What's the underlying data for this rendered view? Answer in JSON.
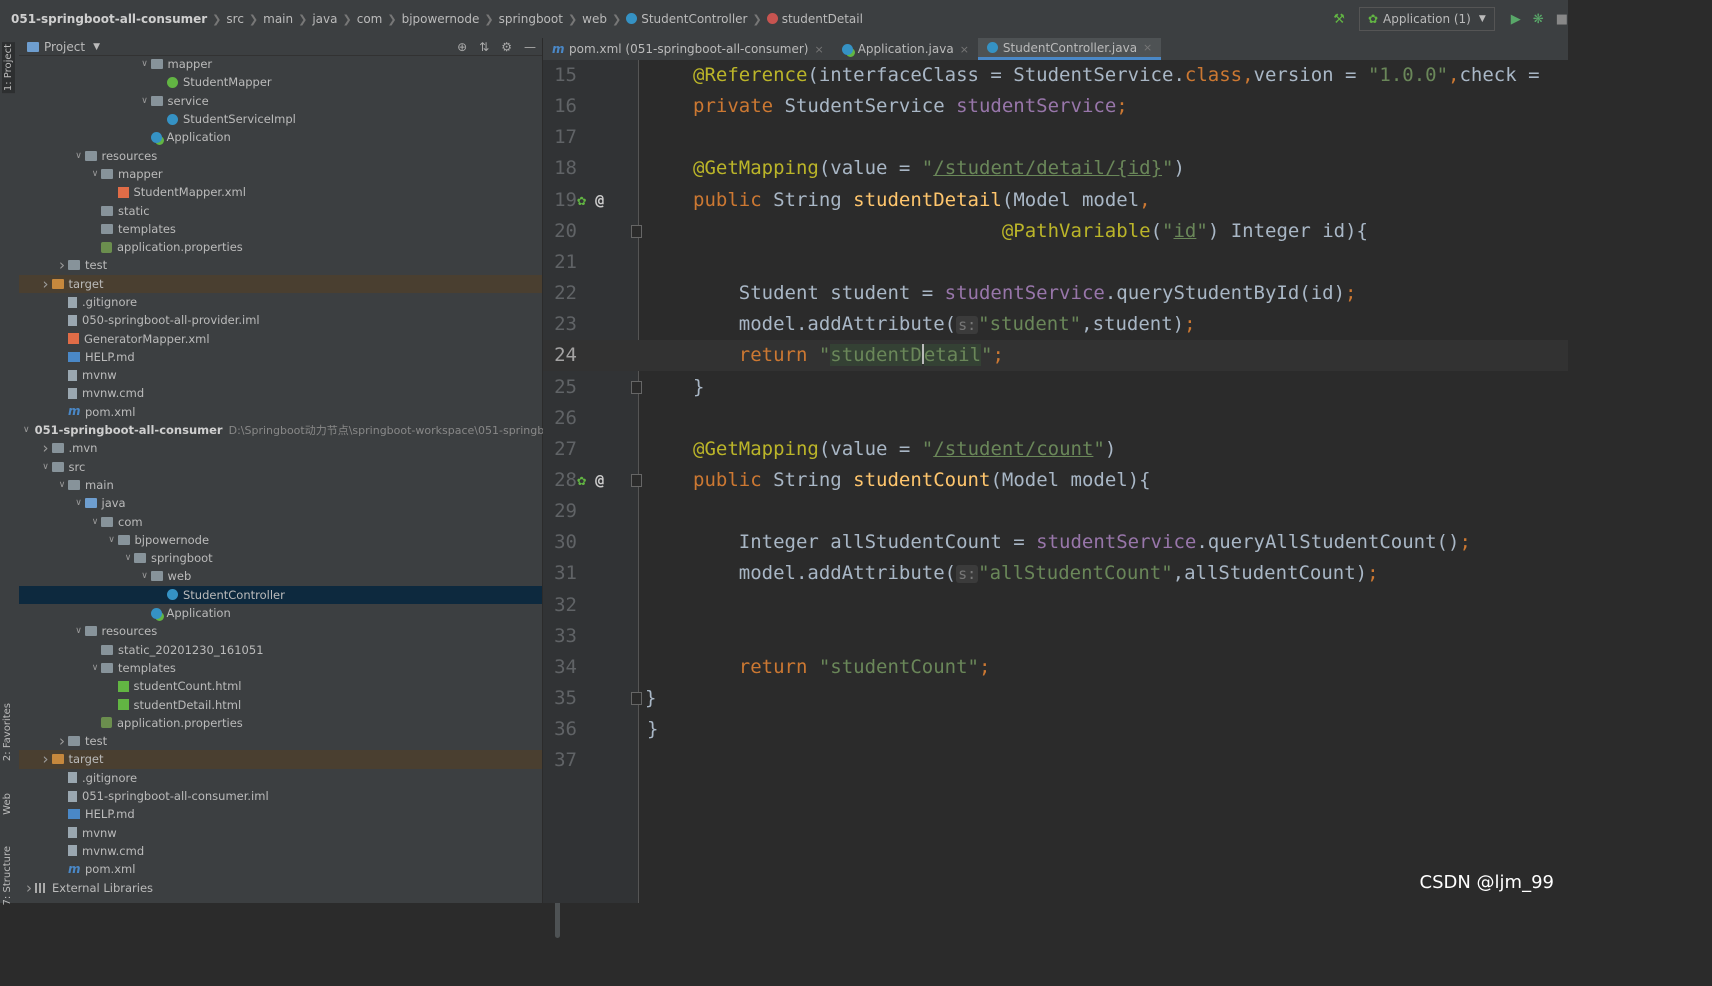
{
  "breadcrumbs": [
    "051-springboot-all-consumer",
    "src",
    "main",
    "java",
    "com",
    "bjpowernode",
    "springboot",
    "web",
    "StudentController",
    "studentDetail"
  ],
  "toolbar": {
    "run_config": "Application (1)"
  },
  "side_tabs": {
    "project": "1: Project",
    "favorites": "2: Favorites",
    "web": "Web",
    "structure": "7: Structure"
  },
  "project_panel": {
    "title": "Project"
  },
  "tree": [
    {
      "depth": 7,
      "arrow": "v",
      "icon": "folder",
      "label": "mapper"
    },
    {
      "depth": 8,
      "arrow": "",
      "icon": "iface",
      "label": "StudentMapper"
    },
    {
      "depth": 7,
      "arrow": "v",
      "icon": "folder",
      "label": "service"
    },
    {
      "depth": 8,
      "arrow": "",
      "icon": "class",
      "label": "StudentServiceImpl"
    },
    {
      "depth": 7,
      "arrow": "",
      "icon": "spring",
      "label": "Application"
    },
    {
      "depth": 3,
      "arrow": "v",
      "icon": "folder",
      "label": "resources"
    },
    {
      "depth": 4,
      "arrow": "v",
      "icon": "folder",
      "label": "mapper"
    },
    {
      "depth": 5,
      "arrow": "",
      "icon": "xml",
      "label": "StudentMapper.xml"
    },
    {
      "depth": 4,
      "arrow": "",
      "icon": "folder",
      "label": "static"
    },
    {
      "depth": 4,
      "arrow": "",
      "icon": "folder",
      "label": "templates"
    },
    {
      "depth": 4,
      "arrow": "",
      "icon": "props",
      "label": "application.properties"
    },
    {
      "depth": 2,
      "arrow": ">",
      "icon": "folder",
      "label": "test"
    },
    {
      "depth": 1,
      "arrow": ">",
      "icon": "folder-orange",
      "label": "target",
      "cls": "tgt"
    },
    {
      "depth": 2,
      "arrow": "",
      "icon": "file",
      "label": ".gitignore"
    },
    {
      "depth": 2,
      "arrow": "",
      "icon": "file",
      "label": "050-springboot-all-provider.iml"
    },
    {
      "depth": 2,
      "arrow": "",
      "icon": "xml",
      "label": "GeneratorMapper.xml"
    },
    {
      "depth": 2,
      "arrow": "",
      "icon": "md",
      "label": "HELP.md"
    },
    {
      "depth": 2,
      "arrow": "",
      "icon": "file",
      "label": "mvnw"
    },
    {
      "depth": 2,
      "arrow": "",
      "icon": "file",
      "label": "mvnw.cmd"
    },
    {
      "depth": 2,
      "arrow": "",
      "icon": "m",
      "label": "pom.xml"
    },
    {
      "depth": 0,
      "arrow": "v",
      "icon": "folder",
      "label": "051-springboot-all-consumer",
      "bold": true,
      "hint": "D:\\Springboot动力节点\\springboot-workspace\\051-springb"
    },
    {
      "depth": 1,
      "arrow": ">",
      "icon": "folder",
      "label": ".mvn"
    },
    {
      "depth": 1,
      "arrow": "v",
      "icon": "folder",
      "label": "src"
    },
    {
      "depth": 2,
      "arrow": "v",
      "icon": "folder",
      "label": "main"
    },
    {
      "depth": 3,
      "arrow": "v",
      "icon": "folder-blue",
      "label": "java"
    },
    {
      "depth": 4,
      "arrow": "v",
      "icon": "folder",
      "label": "com"
    },
    {
      "depth": 5,
      "arrow": "v",
      "icon": "folder",
      "label": "bjpowernode"
    },
    {
      "depth": 6,
      "arrow": "v",
      "icon": "folder",
      "label": "springboot"
    },
    {
      "depth": 7,
      "arrow": "v",
      "icon": "folder",
      "label": "web"
    },
    {
      "depth": 8,
      "arrow": "",
      "icon": "class",
      "label": "StudentController",
      "cls": "sel"
    },
    {
      "depth": 7,
      "arrow": "",
      "icon": "spring",
      "label": "Application"
    },
    {
      "depth": 3,
      "arrow": "v",
      "icon": "folder",
      "label": "resources"
    },
    {
      "depth": 4,
      "arrow": "",
      "icon": "folder",
      "label": "static_20201230_161051"
    },
    {
      "depth": 4,
      "arrow": "v",
      "icon": "folder",
      "label": "templates"
    },
    {
      "depth": 5,
      "arrow": "",
      "icon": "html",
      "label": "studentCount.html"
    },
    {
      "depth": 5,
      "arrow": "",
      "icon": "html",
      "label": "studentDetail.html"
    },
    {
      "depth": 4,
      "arrow": "",
      "icon": "props",
      "label": "application.properties"
    },
    {
      "depth": 2,
      "arrow": ">",
      "icon": "folder",
      "label": "test"
    },
    {
      "depth": 1,
      "arrow": ">",
      "icon": "folder-orange",
      "label": "target",
      "cls": "tgt"
    },
    {
      "depth": 2,
      "arrow": "",
      "icon": "file",
      "label": ".gitignore"
    },
    {
      "depth": 2,
      "arrow": "",
      "icon": "file",
      "label": "051-springboot-all-consumer.iml"
    },
    {
      "depth": 2,
      "arrow": "",
      "icon": "md",
      "label": "HELP.md"
    },
    {
      "depth": 2,
      "arrow": "",
      "icon": "file",
      "label": "mvnw"
    },
    {
      "depth": 2,
      "arrow": "",
      "icon": "file",
      "label": "mvnw.cmd"
    },
    {
      "depth": 2,
      "arrow": "",
      "icon": "m",
      "label": "pom.xml"
    },
    {
      "depth": 0,
      "arrow": ">",
      "icon": "libs",
      "label": "External Libraries"
    }
  ],
  "editor_tabs": [
    {
      "label": "pom.xml (051-springboot-all-consumer)",
      "icon": "m"
    },
    {
      "label": "Application.java",
      "icon": "spring"
    },
    {
      "label": "StudentController.java",
      "icon": "class",
      "active": true
    }
  ],
  "code_lines": [
    {
      "n": "15",
      "tokens": [
        [
          "ann",
          "@Reference"
        ],
        [
          "",
          "(interfaceClass = StudentService."
        ],
        [
          "kw",
          "class"
        ],
        [
          "kw",
          ","
        ],
        [
          "",
          "version = "
        ],
        [
          "str",
          "\"1.0.0\""
        ],
        [
          "kw",
          ","
        ],
        [
          "",
          "check ="
        ]
      ]
    },
    {
      "n": "16",
      "tokens": [
        [
          "kw",
          "private "
        ],
        [
          "",
          "StudentService "
        ],
        [
          "field",
          "studentService"
        ],
        [
          "kw",
          ";"
        ]
      ]
    },
    {
      "n": "17",
      "tokens": []
    },
    {
      "n": "18",
      "tokens": [
        [
          "ann",
          "@GetMapping"
        ],
        [
          "",
          "(value = "
        ],
        [
          "str",
          "\""
        ],
        [
          "url",
          "/student/detail/{id}"
        ],
        [
          "str",
          "\""
        ],
        [
          "",
          ")"
        ]
      ]
    },
    {
      "n": "19",
      "gutter": "bean",
      "tokens": [
        [
          "kw",
          "public "
        ],
        [
          "",
          "String "
        ],
        [
          "meth",
          "studentDetail"
        ],
        [
          "",
          "(Model model"
        ],
        [
          "kw",
          ","
        ]
      ]
    },
    {
      "n": "20",
      "fold": true,
      "tokens": [
        [
          "",
          "                           "
        ],
        [
          "ann",
          "@PathVariable"
        ],
        [
          "",
          "("
        ],
        [
          "str",
          "\""
        ],
        [
          "url",
          "id"
        ],
        [
          "str",
          "\""
        ],
        [
          "",
          ") Integer id){"
        ]
      ]
    },
    {
      "n": "21",
      "tokens": []
    },
    {
      "n": "22",
      "tokens": [
        [
          "",
          "    Student student = "
        ],
        [
          "field",
          "studentService"
        ],
        [
          "",
          ".queryStudentById(id)"
        ],
        [
          "kw",
          ";"
        ]
      ]
    },
    {
      "n": "23",
      "tokens": [
        [
          "",
          "    model.addAttribute("
        ],
        [
          "hint",
          "s:"
        ],
        [
          "str",
          "\"student\""
        ],
        [
          "",
          ","
        ],
        [
          "",
          "student)"
        ],
        [
          "kw",
          ";"
        ]
      ]
    },
    {
      "n": "24",
      "cur": true,
      "tokens": [
        [
          "kw",
          "    return "
        ],
        [
          "str",
          "\""
        ],
        [
          "strhl",
          "studentD"
        ],
        [
          "caret",
          ""
        ],
        [
          "strhl",
          "etail"
        ],
        [
          "str",
          "\""
        ],
        [
          "kw",
          ";"
        ]
      ]
    },
    {
      "n": "25",
      "fold": true,
      "tokens": [
        [
          "",
          "}"
        ]
      ]
    },
    {
      "n": "26",
      "tokens": []
    },
    {
      "n": "27",
      "tokens": [
        [
          "ann",
          "@GetMapping"
        ],
        [
          "",
          "(value = "
        ],
        [
          "str",
          "\""
        ],
        [
          "url",
          "/student/count"
        ],
        [
          "str",
          "\""
        ],
        [
          "",
          ")"
        ]
      ]
    },
    {
      "n": "28",
      "gutter": "bean",
      "fold": true,
      "tokens": [
        [
          "kw",
          "public "
        ],
        [
          "",
          "String "
        ],
        [
          "meth",
          "studentCount"
        ],
        [
          "",
          "(Model model){"
        ]
      ]
    },
    {
      "n": "29",
      "tokens": []
    },
    {
      "n": "30",
      "tokens": [
        [
          "",
          "    Integer allStudentCount = "
        ],
        [
          "field",
          "studentService"
        ],
        [
          "",
          ".queryAllStudentCount()"
        ],
        [
          "kw",
          ";"
        ]
      ]
    },
    {
      "n": "31",
      "tokens": [
        [
          "",
          "    model.addAttribute("
        ],
        [
          "hint",
          "s:"
        ],
        [
          "str",
          "\"allStudentCount\""
        ],
        [
          "",
          ","
        ],
        [
          "",
          "allStudentCount)"
        ],
        [
          "kw",
          ";"
        ]
      ]
    },
    {
      "n": "32",
      "tokens": []
    },
    {
      "n": "33",
      "tokens": []
    },
    {
      "n": "34",
      "tokens": [
        [
          "kw",
          "    return "
        ],
        [
          "str",
          "\"studentCount\""
        ],
        [
          "kw",
          ";"
        ]
      ]
    },
    {
      "n": "35",
      "fold": true,
      "tokens": [
        [
          "",
          "}"
        ]
      ]
    },
    {
      "n": "36",
      "tokens": [
        [
          "",
          "}"
        ]
      ],
      "outdent": true
    },
    {
      "n": "37",
      "tokens": []
    }
  ],
  "watermark": "CSDN @ljm_99",
  "colors": {
    "background": "#2b2b2b",
    "panel": "#3c3f41",
    "selection": "#0d293e",
    "accent": "#4a88c7"
  }
}
